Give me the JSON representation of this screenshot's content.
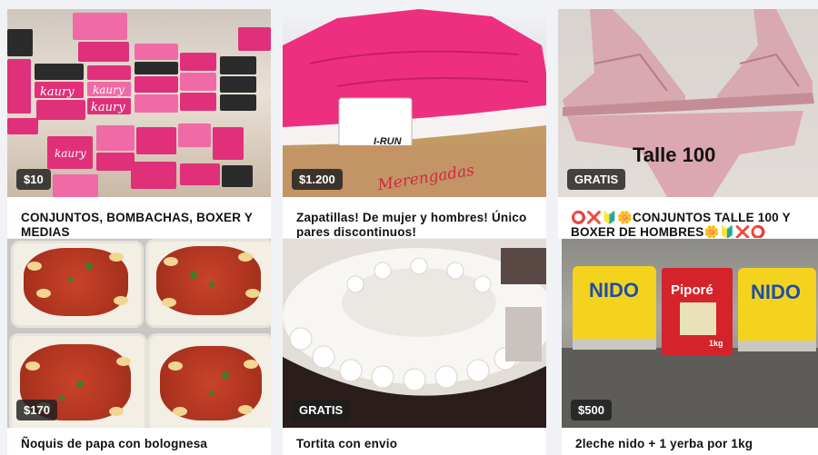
{
  "listings": [
    {
      "price": "$10",
      "title": "CONJUNTOS, BOMBACHAS, BOXER Y MEDIAS",
      "image": "pink-shoe-boxes"
    },
    {
      "price": "$1.200",
      "title": "Zapatillas! De mujer y hombres! Único pares discontinuos!",
      "image": "pink-sneaker"
    },
    {
      "price": "GRATIS",
      "title": "⭕❌🔰🌼CONJUNTOS TALLE 100 Y BOXER DE HOMBRES🌼🔰❌⭕",
      "image": "pink-lingerie",
      "overlay": "Talle 100"
    },
    {
      "price": "$170",
      "title": "Ñoquis de papa con bolognesa",
      "image": "gnocchi-trays"
    },
    {
      "price": "GRATIS",
      "title": "Tortita con envio",
      "image": "white-cake"
    },
    {
      "price": "$500",
      "title": "2leche nido + 1 yerba por 1kg",
      "image": "milk-cans"
    }
  ],
  "image_text": {
    "brand_box": "kaury",
    "shoe_tag": "I-RUN",
    "shoe_box": "Merengadas",
    "can_brand": "NIDO",
    "yerba_brand": "Piporé",
    "yerba_weight": "1kg"
  },
  "colors": {
    "price_badge_bg": "#1e1e1e",
    "background": "#f0f2f5",
    "card": "#ffffff"
  }
}
